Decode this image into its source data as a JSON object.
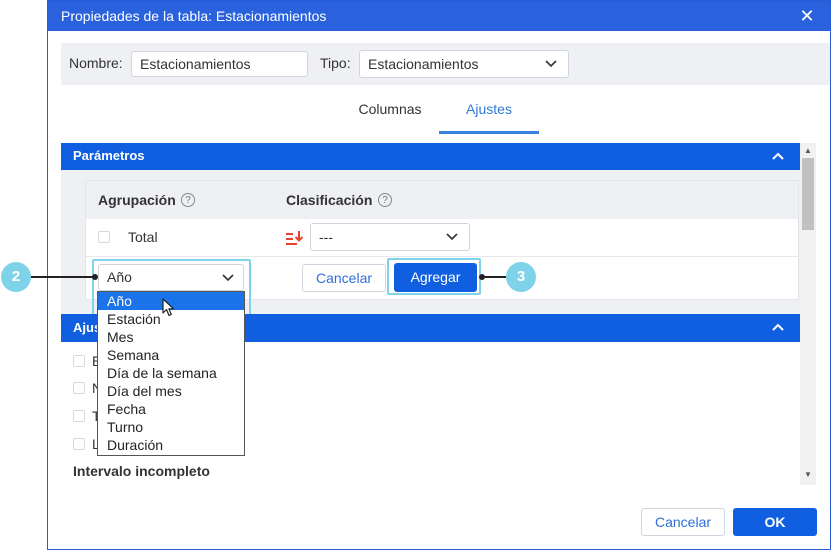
{
  "dialog": {
    "title": "Propiedades de la tabla: Estacionamientos"
  },
  "fields": {
    "name_label": "Nombre:",
    "name_value": "Estacionamientos",
    "type_label": "Tipo:",
    "type_value": "Estacionamientos"
  },
  "tabs": [
    {
      "label": "Columnas"
    },
    {
      "label": "Ajustes"
    }
  ],
  "params_section": {
    "title": "Parámetros"
  },
  "grouping": {
    "col_grouping": "Agrupación",
    "col_sorting": "Clasificación",
    "help_glyph": "?",
    "total_label": "Total",
    "sort_value": "---",
    "group_select_value": "Año",
    "cancel_label": "Cancelar",
    "add_label": "Agregar"
  },
  "dropdown_options": [
    "Año",
    "Estación",
    "Mes",
    "Semana",
    "Día de la semana",
    "Día del mes",
    "Fecha",
    "Turno",
    "Duración"
  ],
  "settings_section": {
    "title_partial": "Ajus",
    "row_letters": [
      "E",
      "N",
      "T",
      "L"
    ],
    "incomplete_interval": "Intervalo incompleto"
  },
  "footer": {
    "cancel_label": "Cancelar",
    "ok_label": "OK"
  },
  "callouts": [
    "2",
    "3"
  ],
  "colors": {
    "title_bar": "#2a62dd",
    "section_bar": "#0f5fe0",
    "accent_link": "#2f7bd9",
    "callout": "#7fd3e8",
    "selected_option": "#1a73e8"
  }
}
